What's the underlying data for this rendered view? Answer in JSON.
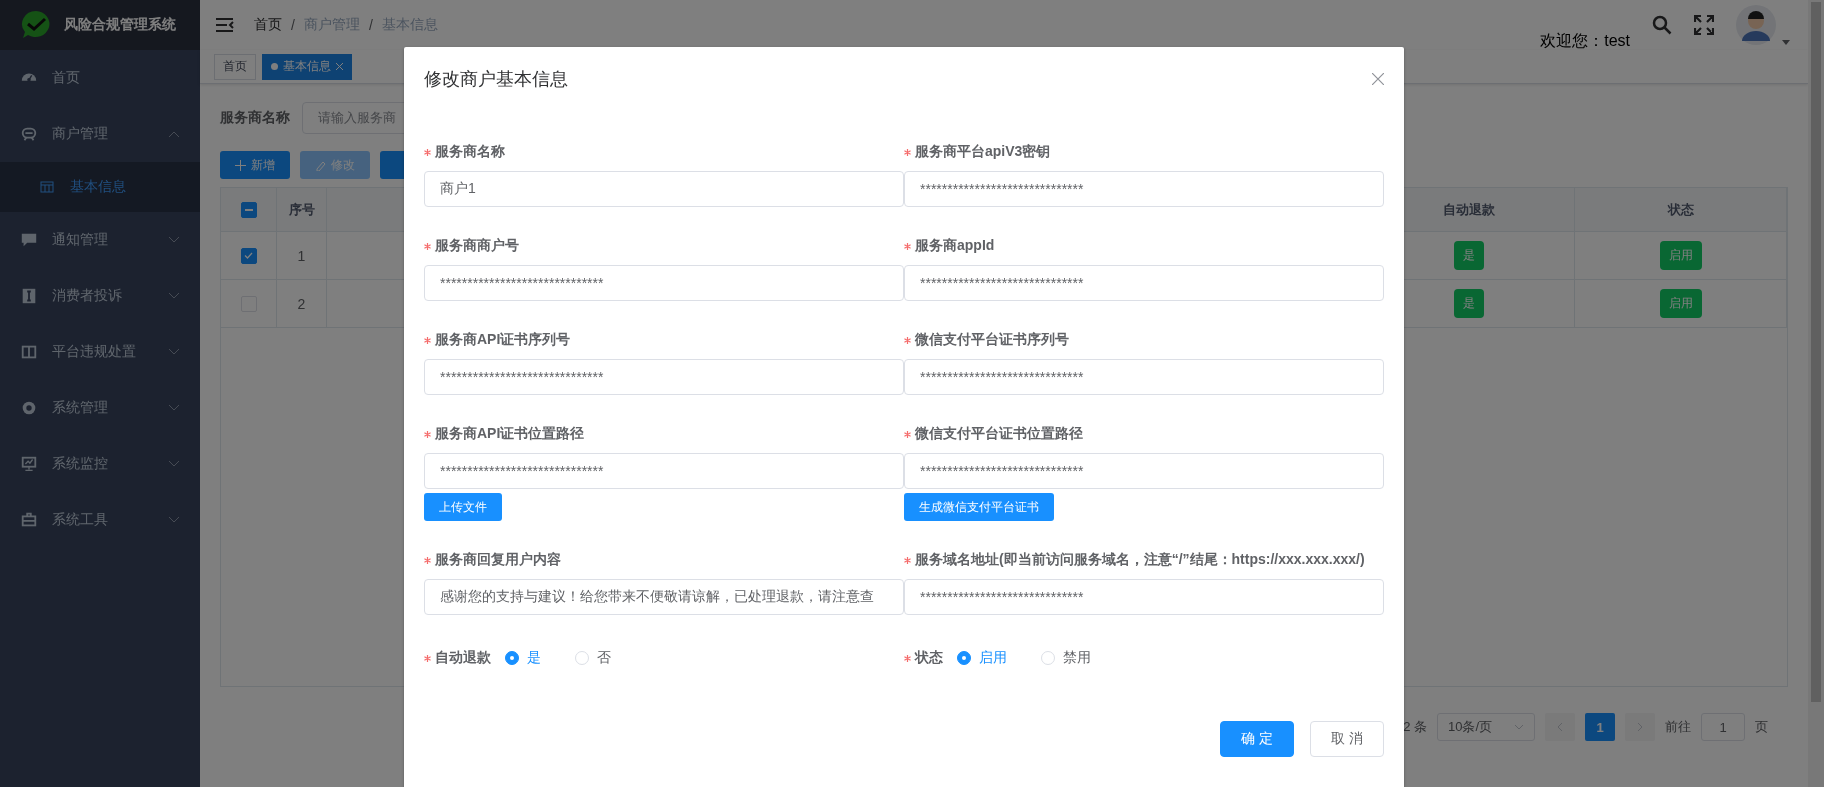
{
  "sidebar": {
    "title": "风险合规管理系统",
    "items": [
      {
        "label": "首页",
        "kind": "link"
      },
      {
        "label": "商户管理",
        "kind": "submenu",
        "expanded": true,
        "children": [
          {
            "label": "基本信息",
            "selected": true
          }
        ]
      },
      {
        "label": "通知管理",
        "kind": "submenu",
        "expanded": false
      },
      {
        "label": "消费者投诉",
        "kind": "submenu",
        "expanded": false
      },
      {
        "label": "平台违规处置",
        "kind": "submenu",
        "expanded": false
      },
      {
        "label": "系统管理",
        "kind": "submenu",
        "expanded": false
      },
      {
        "label": "系统监控",
        "kind": "submenu",
        "expanded": false
      },
      {
        "label": "系统工具",
        "kind": "submenu",
        "expanded": false
      }
    ]
  },
  "header": {
    "breadcrumb": {
      "separator": "/",
      "items": [
        "首页",
        "商户管理",
        "基本信息"
      ]
    },
    "welcome": "欢迎您：test"
  },
  "tags": [
    {
      "label": "首页",
      "selected": false
    },
    {
      "label": "基本信息",
      "selected": true
    }
  ],
  "search": {
    "label": "服务商名称",
    "placeholder": "请输入服务商"
  },
  "toolbar": [
    {
      "kind": "add",
      "label": "新增",
      "disabled": false
    },
    {
      "kind": "edit",
      "label": "修改",
      "disabled": true
    },
    {
      "kind": "other",
      "disabled": false
    }
  ],
  "table": {
    "select_all": {
      "indeterminate": true
    },
    "columns": [
      {
        "label": "序号"
      },
      {
        "label": "自动退款"
      },
      {
        "label": "状态"
      }
    ],
    "rows": [
      {
        "checked": true,
        "index": "1",
        "auto_refund": "是",
        "status": "启用"
      },
      {
        "checked": false,
        "index": "2",
        "auto_refund": "是",
        "status": "启用"
      }
    ]
  },
  "pagination": {
    "total": "2 条",
    "page_size": "10条/页",
    "pages": [
      {
        "label": "1",
        "selected": true
      }
    ],
    "goto_label": "前往",
    "goto_value": "1",
    "goto_suffix": "页"
  },
  "dialog": {
    "title": "修改商户基本信息",
    "fields": [
      {
        "label": "服务商名称",
        "required": true,
        "value": "商户1"
      },
      {
        "label": "服务商平台apiV3密钥",
        "required": true,
        "value": "******************************"
      },
      {
        "label": "服务商商户号",
        "required": true,
        "value": "******************************"
      },
      {
        "label": "服务商appId",
        "required": true,
        "value": "******************************"
      },
      {
        "label": "服务商API证书序列号",
        "required": true,
        "value": "******************************"
      },
      {
        "label": "微信支付平台证书序列号",
        "required": true,
        "value": "******************************"
      },
      {
        "label": "服务商API证书位置路径",
        "required": true,
        "value": "******************************",
        "button": "上传文件"
      },
      {
        "label": "微信支付平台证书位置路径",
        "required": true,
        "value": "******************************",
        "button": "生成微信支付平台证书"
      },
      {
        "label": "服务商回复用户内容",
        "required": true,
        "value": "感谢您的支持与建议！给您带来不便敬请谅解，已处理退款，请注意查"
      },
      {
        "label": "服务域名地址(即当前访问服务域名，注意“/”结尾：https://xxx.xxx.xxx/)",
        "required": true,
        "value": "******************************"
      }
    ],
    "radios": [
      {
        "label": "自动退款",
        "required": true,
        "options": [
          {
            "label": "是",
            "selected": true
          },
          {
            "label": "否",
            "selected": false
          }
        ]
      },
      {
        "label": "状态",
        "required": true,
        "options": [
          {
            "label": "启用",
            "selected": true
          },
          {
            "label": "禁用",
            "selected": false
          }
        ]
      }
    ],
    "buttons": [
      {
        "label": "确 定",
        "kind": "primary"
      },
      {
        "label": "取 消",
        "kind": "default"
      }
    ]
  }
}
